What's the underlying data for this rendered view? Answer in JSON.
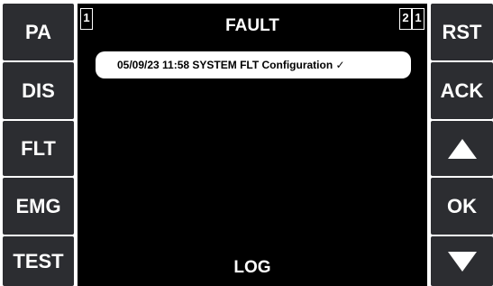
{
  "left_buttons": [
    {
      "label": "PA"
    },
    {
      "label": "DIS"
    },
    {
      "label": "FLT"
    },
    {
      "label": "EMG"
    },
    {
      "label": "TEST"
    }
  ],
  "right_buttons": {
    "reset_label": "RST",
    "ack_label": "ACK",
    "up_icon": "triangle-up-icon",
    "ok_label": "OK",
    "down_icon": "triangle-down-icon"
  },
  "screen": {
    "title": "FAULT",
    "left_counter": "1",
    "right_counter_a": "2",
    "right_counter_b": "1",
    "events": [
      {
        "text": "05/09/23 11:58 SYSTEM FLT Configuration ✓"
      }
    ],
    "footer_label": "LOG"
  },
  "colors": {
    "button_bg": "#2c2d31",
    "screen_bg": "#000000",
    "text": "#ffffff"
  }
}
